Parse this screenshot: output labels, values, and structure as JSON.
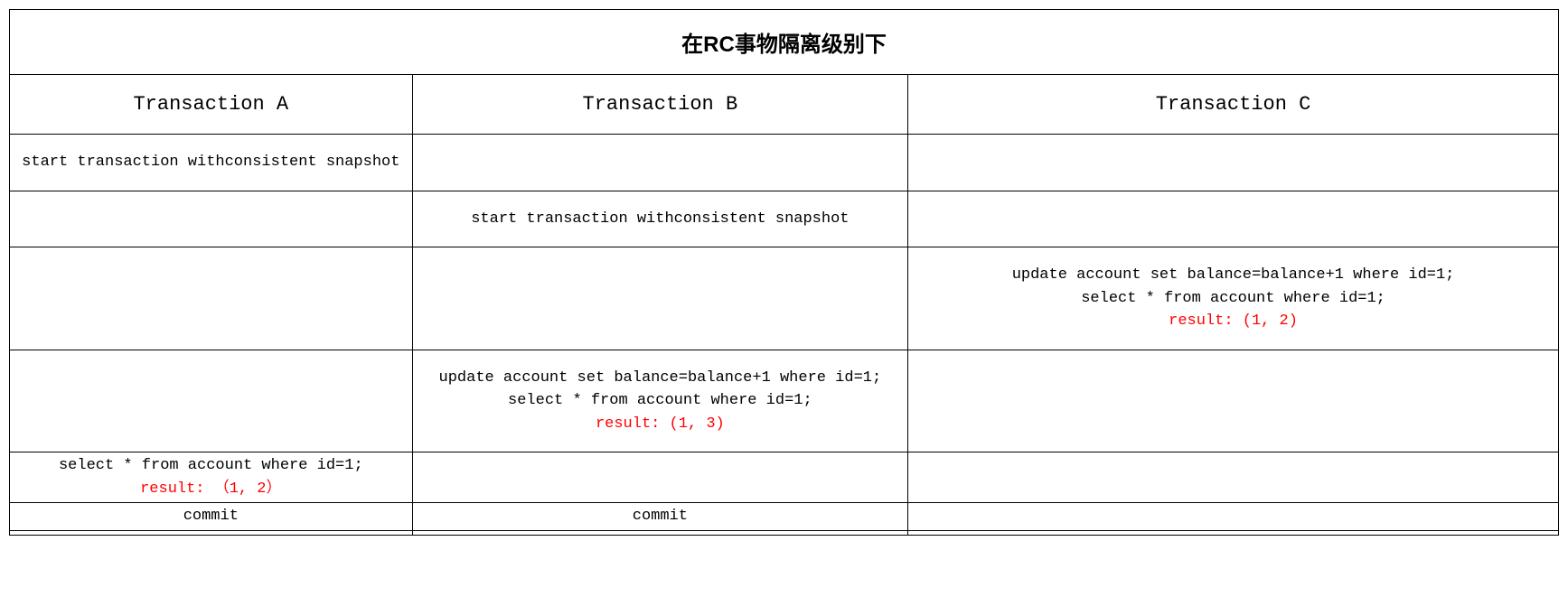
{
  "title": "在RC事物隔离级别下",
  "columns": [
    "Transaction A",
    "Transaction B",
    "Transaction C"
  ],
  "rows": [
    {
      "a": {
        "lines": [
          "start transaction withconsistent snapshot"
        ],
        "result": null
      },
      "b": {
        "lines": [],
        "result": null
      },
      "c": {
        "lines": [],
        "result": null
      }
    },
    {
      "a": {
        "lines": [],
        "result": null
      },
      "b": {
        "lines": [
          "start transaction withconsistent snapshot"
        ],
        "result": null
      },
      "c": {
        "lines": [],
        "result": null
      }
    },
    {
      "a": {
        "lines": [],
        "result": null
      },
      "b": {
        "lines": [],
        "result": null
      },
      "c": {
        "lines": [
          "update account set balance=balance+1 where id=1;",
          "select * from account where id=1;"
        ],
        "result": "result: (1, 2)"
      }
    },
    {
      "a": {
        "lines": [],
        "result": null
      },
      "b": {
        "lines": [
          "update account set balance=balance+1 where id=1;",
          "select * from account where id=1;"
        ],
        "result": "result: (1, 3)"
      },
      "c": {
        "lines": [],
        "result": null
      }
    },
    {
      "short": true,
      "a": {
        "lines": [
          "select * from account where id=1;"
        ],
        "result": "result: （1, 2）"
      },
      "b": {
        "lines": [],
        "result": null
      },
      "c": {
        "lines": [],
        "result": null
      }
    },
    {
      "short": true,
      "a": {
        "lines": [
          "commit"
        ],
        "result": null
      },
      "b": {
        "lines": [
          "commit"
        ],
        "result": null
      },
      "c": {
        "lines": [],
        "result": null
      }
    },
    {
      "short": true,
      "a": {
        "lines": [],
        "result": null
      },
      "b": {
        "lines": [],
        "result": null
      },
      "c": {
        "lines": [],
        "result": null
      }
    }
  ]
}
